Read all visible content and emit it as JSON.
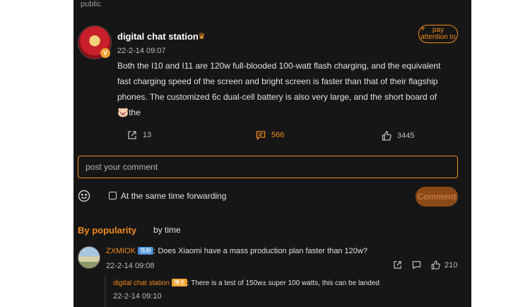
{
  "header": {
    "visibility": "public"
  },
  "post": {
    "avatar_badge": "V",
    "username": "digital chat station",
    "crown_icon": "crown-icon",
    "time": "22-2-14 09:07",
    "follow_plus": "+",
    "follow_label": "pay attention to",
    "body": "Both the I10 and I11 are 120w full-blooded 100-watt flash charging, and the equivalent fast charging speed of the screen and bright screen is faster than that of their flagship phones. The customized 6c dual-cell battery is also very large, and the short board of",
    "body_tail": "the",
    "emoji": "🐷",
    "actions": {
      "share": "13",
      "comments": "566",
      "likes": "3445"
    }
  },
  "composer": {
    "placeholder": "post your comment",
    "forward_label": "At the same time forwarding",
    "submit_label": "Comment",
    "forward_checked": false
  },
  "sort_tabs": {
    "popularity": "By popularity",
    "time": "by time"
  },
  "comments": [
    {
      "user": "ZXMIOK",
      "tag": "铁粉",
      "text": ": Does Xiaomi have a mass production plan faster than 120w?",
      "time": "22-2-14 09:08",
      "likes": "210",
      "reply": {
        "user": "digital chat station",
        "tag": "博主",
        "text": ": There is a test of 150w± super 100 watts, this can be landed",
        "time": "22-2-14 09:10"
      }
    }
  ],
  "colors": {
    "accent": "#f08a1c",
    "panel_bg": "#161616"
  }
}
